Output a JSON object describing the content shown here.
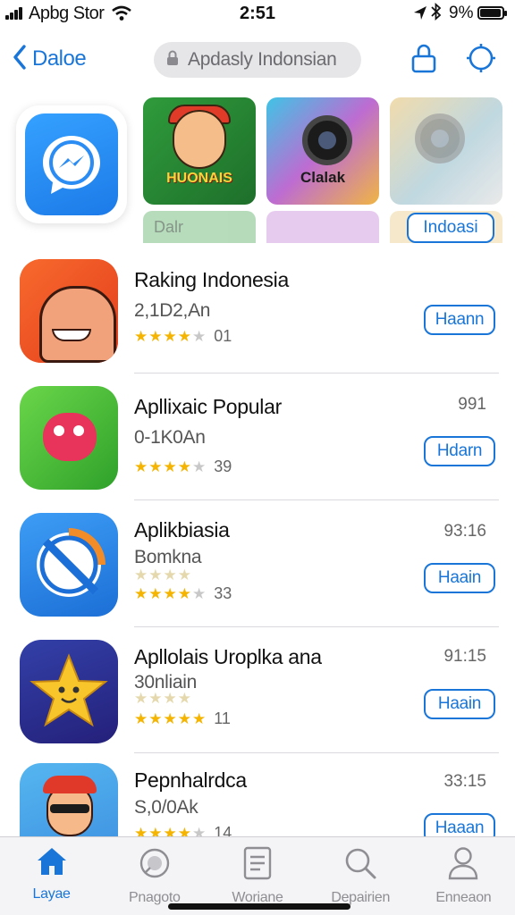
{
  "status_bar": {
    "carrier": "Apbg Stor",
    "time": "2:51",
    "battery_text": "9%",
    "battery_level": 0.95
  },
  "nav": {
    "back_label": "Daloe",
    "search_text": "Apdasly Indonsian",
    "icons": [
      "chevron-left-icon",
      "lock-icon",
      "lock-icon",
      "location-target-icon"
    ]
  },
  "featured": {
    "thumbnails": [
      {
        "label": "HUONAIS"
      },
      {
        "label": "Clalak"
      },
      {
        "label": ""
      }
    ],
    "ghost_label": "Dalr",
    "button_label": "Indoasi"
  },
  "apps": [
    {
      "name": "Raking Indonesia",
      "subtitle": "2,1D2,An",
      "stars": 4,
      "rating_count": "01",
      "meta": "",
      "button": "Haann"
    },
    {
      "name": "Apllixaic Popular",
      "subtitle": "0-1K0An",
      "stars": 4,
      "rating_count": "39",
      "meta": "991",
      "button": "Hdarn"
    },
    {
      "name": "Aplikbiasia",
      "subtitle": "Bomkna",
      "stars": 4,
      "rating_count": "33",
      "meta": "93:16",
      "button": "Haain"
    },
    {
      "name": "Apllolais Uroplka ana",
      "subtitle": "30nliain",
      "stars": 5,
      "rating_count": "11",
      "meta": "91:15",
      "button": "Haain"
    },
    {
      "name": "Pepnhalrdca",
      "subtitle": "S,0/0Ak",
      "stars": 4,
      "rating_count": "14",
      "meta": "33:15",
      "button": "Haaan"
    }
  ],
  "tabs": [
    {
      "label": "Layae",
      "icon": "home-icon",
      "active": true
    },
    {
      "label": "Pnagoto",
      "icon": "compass-icon",
      "active": false
    },
    {
      "label": "Woriane",
      "icon": "document-icon",
      "active": false
    },
    {
      "label": "Depairien",
      "icon": "search-icon",
      "active": false
    },
    {
      "label": "Enneaon",
      "icon": "person-icon",
      "active": false
    }
  ],
  "colors": {
    "accent": "#1976d8",
    "star": "#f4b400",
    "tab_bar_bg": "#f4f4f6"
  }
}
